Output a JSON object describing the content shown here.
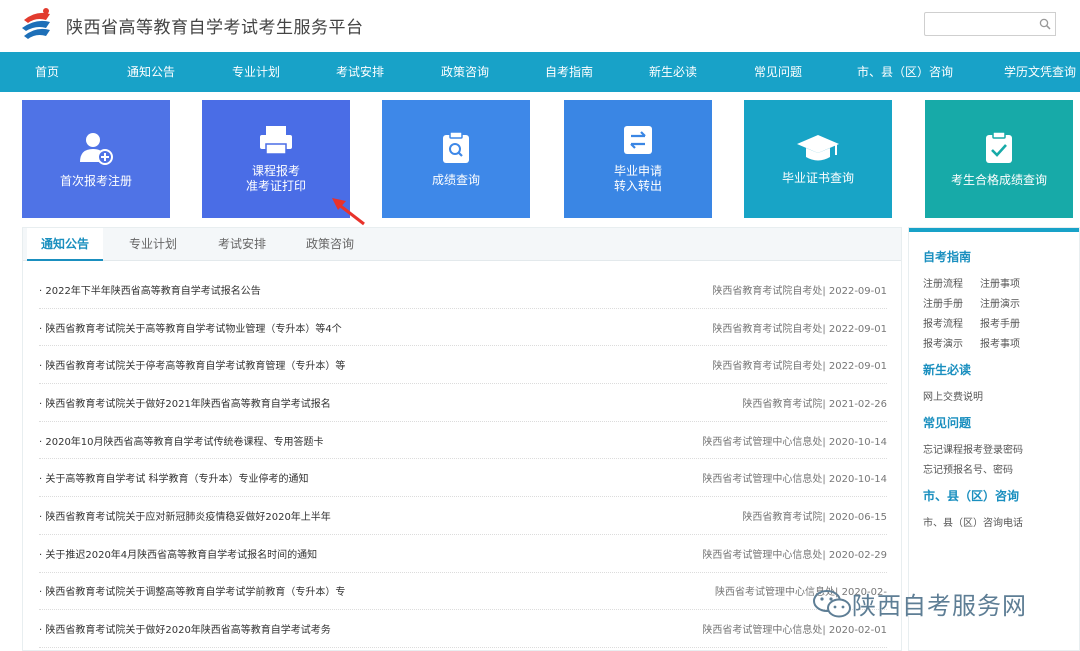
{
  "header": {
    "site_title": "陕西省高等教育自学考试考生服务平台",
    "search_placeholder": ""
  },
  "nav": [
    "首页",
    "通知公告",
    "专业计划",
    "考试安排",
    "政策咨询",
    "自考指南",
    "新生必读",
    "常见问题",
    "市、县（区）咨询",
    "学历文凭查询"
  ],
  "tiles": [
    {
      "label_1": "首次报考注册",
      "label_2": "",
      "icon": "user-add-icon",
      "color": "#4f73e6"
    },
    {
      "label_1": "课程报考",
      "label_2": "准考证打印",
      "icon": "printer-icon",
      "color": "#4a6de6"
    },
    {
      "label_1": "成绩查询",
      "label_2": "",
      "icon": "clipboard-search-icon",
      "color": "#3e88e8"
    },
    {
      "label_1": "毕业申请",
      "label_2": "转入转出",
      "icon": "transfer-icon",
      "color": "#3a86e4"
    },
    {
      "label_1": "毕业证书查询",
      "label_2": "",
      "icon": "graduation-cap-icon",
      "color": "#18a4c6"
    },
    {
      "label_1": "考生合格成绩查询",
      "label_2": "",
      "icon": "clipboard-check-icon",
      "color": "#17aaa8"
    }
  ],
  "tabs": [
    "通知公告",
    "专业计划",
    "考试安排",
    "政策咨询"
  ],
  "news": [
    {
      "title": "· 2022年下半年陕西省高等教育自学考试报名公告",
      "meta": "陕西省教育考试院自考处| 2022-09-01"
    },
    {
      "title": "· 陕西省教育考试院关于高等教育自学考试物业管理（专升本）等4个",
      "meta": "陕西省教育考试院自考处| 2022-09-01"
    },
    {
      "title": "· 陕西省教育考试院关于停考高等教育自学考试教育管理（专升本）等",
      "meta": "陕西省教育考试院自考处| 2022-09-01"
    },
    {
      "title": "· 陕西省教育考试院关于做好2021年陕西省高等教育自学考试报名",
      "meta": "陕西省教育考试院| 2021-02-26"
    },
    {
      "title": "· 2020年10月陕西省高等教育自学考试传统卷课程、专用答题卡",
      "meta": "陕西省考试管理中心信息处| 2020-10-14"
    },
    {
      "title": "· 关于高等教育自学考试 科学教育（专升本）专业停考的通知",
      "meta": "陕西省考试管理中心信息处| 2020-10-14"
    },
    {
      "title": "· 陕西省教育考试院关于应对新冠肺炎疫情稳妥做好2020年上半年",
      "meta": "陕西省教育考试院| 2020-06-15"
    },
    {
      "title": "· 关于推迟2020年4月陕西省高等教育自学考试报名时间的通知",
      "meta": "陕西省考试管理中心信息处| 2020-02-29"
    },
    {
      "title": "· 陕西省教育考试院关于调整高等教育自学考试学前教育（专升本）专",
      "meta": "陕西省考试管理中心信息处| 2020-02-"
    },
    {
      "title": "· 陕西省教育考试院关于做好2020年陕西省高等教育自学考试考务",
      "meta": "陕西省考试管理中心信息处| 2020-02-01"
    }
  ],
  "sidebar": {
    "sec1": "自考指南",
    "sec1_links": [
      "注册流程",
      "注册事项",
      "注册手册",
      "注册演示",
      "报考流程",
      "报考手册",
      "报考演示",
      "报考事项"
    ],
    "sec2": "新生必读",
    "sec2_links": [
      "网上交费说明"
    ],
    "sec3": "常见问题",
    "sec3_links": [
      "忘记课程报考登录密码",
      "忘记预报名号、密码"
    ],
    "sec4": "市、县（区）咨询",
    "sec4_links": [
      "市、县（区）咨询电话"
    ]
  },
  "watermark": "陕西自考服务网",
  "colors": {
    "nav": "#18a2c8",
    "accent": "#1a8fbf",
    "arrow": "#e8322b"
  }
}
